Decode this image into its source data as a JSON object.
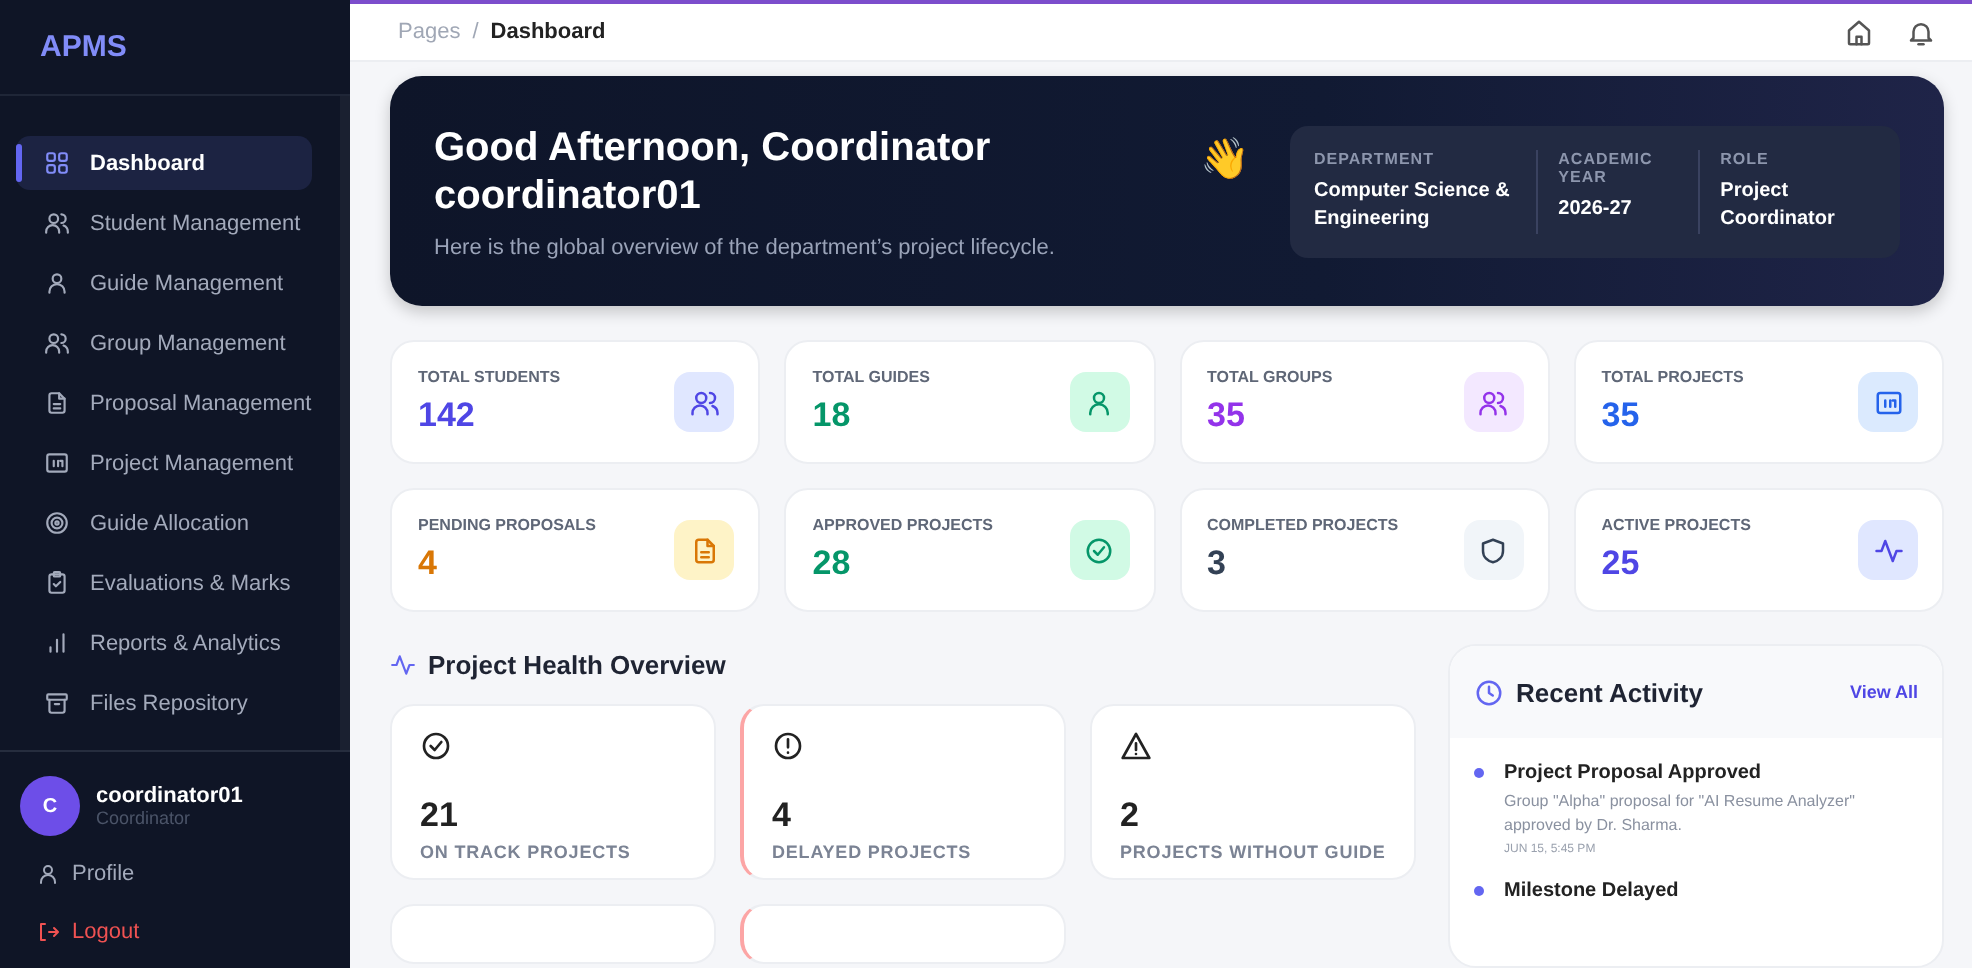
{
  "sidebar": {
    "logo": "APMS",
    "items": [
      {
        "label": "Dashboard",
        "selected": true
      },
      {
        "label": "Student Management",
        "selected": false
      },
      {
        "label": "Guide Management",
        "selected": false
      },
      {
        "label": "Group Management",
        "selected": false
      },
      {
        "label": "Proposal Management",
        "selected": false
      },
      {
        "label": "Project Management",
        "selected": false
      },
      {
        "label": "Guide Allocation",
        "selected": false
      },
      {
        "label": "Evaluations & Marks",
        "selected": false
      },
      {
        "label": "Reports & Analytics",
        "selected": false
      },
      {
        "label": "Files Repository",
        "selected": false
      }
    ],
    "user": {
      "initial": "C",
      "name": "coordinator01",
      "role": "Coordinator"
    },
    "profile": "Profile",
    "logout": "Logout"
  },
  "breadcrumb": {
    "parent": "Pages",
    "separator": "/",
    "current": "Dashboard"
  },
  "hero": {
    "greeting": "Good Afternoon, Coordinator",
    "username": "coordinator01",
    "subtitle": "Here is the global overview of the department’s project lifecycle.",
    "emoji": "👋",
    "info": [
      {
        "label": "DEPARTMENT",
        "value": "Computer Science & Engineering"
      },
      {
        "label": "ACADEMIC YEAR",
        "value": "2026-27"
      },
      {
        "label": "ROLE",
        "value": "Project Coordinator"
      }
    ]
  },
  "stats": [
    {
      "label": "TOTAL STUDENTS",
      "value": "142",
      "color": "#4f46e5"
    },
    {
      "label": "TOTAL GUIDES",
      "value": "18",
      "color": "#059669"
    },
    {
      "label": "TOTAL GROUPS",
      "value": "35",
      "color": "#9333ea"
    },
    {
      "label": "TOTAL PROJECTS",
      "value": "35",
      "color": "#2563eb"
    },
    {
      "label": "PENDING PROPOSALS",
      "value": "4",
      "color": "#d97706"
    },
    {
      "label": "APPROVED PROJECTS",
      "value": "28",
      "color": "#059669"
    },
    {
      "label": "COMPLETED PROJECTS",
      "value": "3",
      "color": "#334155"
    },
    {
      "label": "ACTIVE PROJECTS",
      "value": "25",
      "color": "#4f46e5"
    }
  ],
  "health": {
    "title": "Project Health Overview",
    "cards": [
      {
        "value": "21",
        "label": "ON TRACK PROJECTS",
        "alert": false
      },
      {
        "value": "4",
        "label": "DELAYED PROJECTS",
        "alert": true
      },
      {
        "value": "2",
        "label": "PROJECTS WITHOUT GUIDE",
        "alert": false
      },
      {
        "alert": false
      },
      {
        "alert": true
      }
    ]
  },
  "activity": {
    "title": "Recent Activity",
    "link": "View All",
    "items": [
      {
        "title": "Project Proposal Approved",
        "detail": "Group \"Alpha\" proposal for \"AI Resume Analyzer\" approved by Dr. Sharma.",
        "time": "JUN 15, 5:45 PM"
      },
      {
        "title": "Milestone Delayed"
      }
    ]
  }
}
